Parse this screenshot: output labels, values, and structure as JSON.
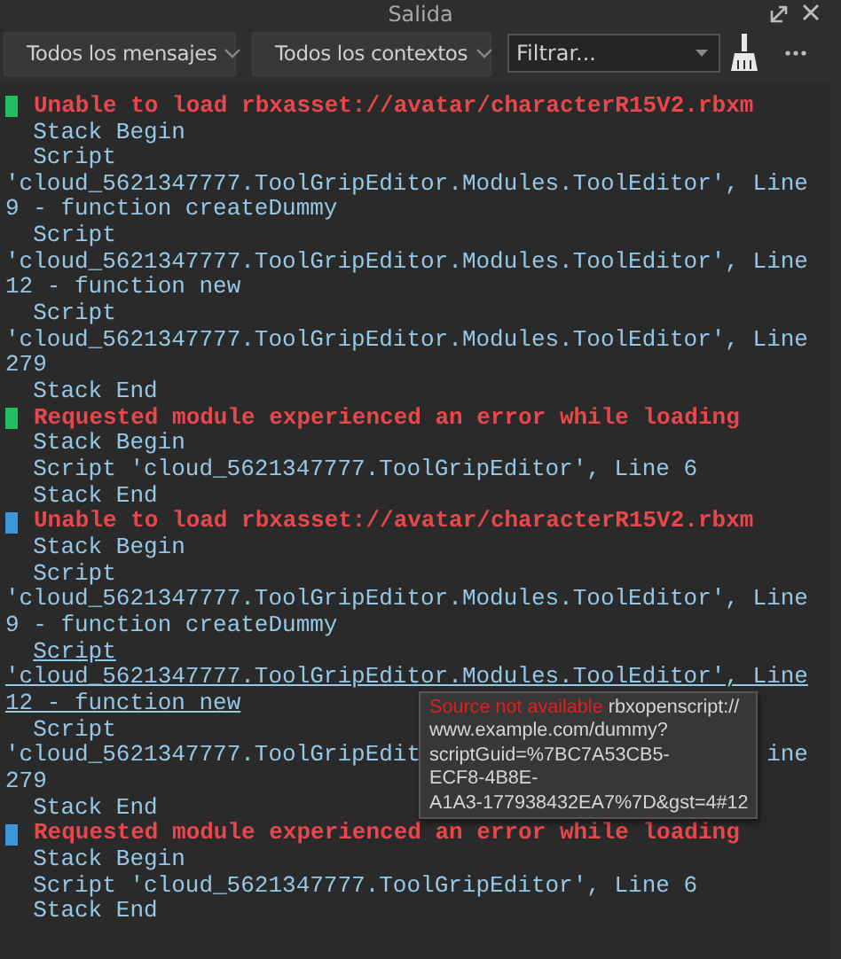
{
  "window": {
    "title": "Salida"
  },
  "toolbar": {
    "message_filter": "Todos los mensajes",
    "context_filter": "Todos los contextos",
    "search": {
      "placeholder": "Filtrar..."
    }
  },
  "messages": [
    {
      "color": "#1fbf5f",
      "title": "Unable to load rbxasset://avatar/characterR15V2.rbxm",
      "lines": [
        {
          "kind": "frame",
          "text": "Stack Begin",
          "hovered": false
        },
        {
          "kind": "frame",
          "text": "Script",
          "hovered": false
        },
        {
          "kind": "cont",
          "text": "'cloud_5621347777.ToolGripEditor.Modules.ToolEditor', Line",
          "hovered": false
        },
        {
          "kind": "cont",
          "text": "9 - function createDummy",
          "hovered": false
        },
        {
          "kind": "frame",
          "text": "Script",
          "hovered": false
        },
        {
          "kind": "cont",
          "text": "'cloud_5621347777.ToolGripEditor.Modules.ToolEditor', Line",
          "hovered": false
        },
        {
          "kind": "cont",
          "text": "12 - function new",
          "hovered": false
        },
        {
          "kind": "frame",
          "text": "Script",
          "hovered": false
        },
        {
          "kind": "cont",
          "text": "'cloud_5621347777.ToolGripEditor.Modules.ToolEditor', Line",
          "hovered": false
        },
        {
          "kind": "cont",
          "text": "279",
          "hovered": false
        },
        {
          "kind": "frame",
          "text": "Stack End",
          "hovered": false
        }
      ]
    },
    {
      "color": "#1fbf5f",
      "title": "Requested module experienced an error while loading",
      "lines": [
        {
          "kind": "frame",
          "text": "Stack Begin",
          "hovered": false
        },
        {
          "kind": "frame",
          "text": "Script 'cloud_5621347777.ToolGripEditor', Line 6",
          "hovered": false
        },
        {
          "kind": "frame",
          "text": "Stack End",
          "hovered": false
        }
      ]
    },
    {
      "color": "#3a96dd",
      "title": "Unable to load rbxasset://avatar/characterR15V2.rbxm",
      "lines": [
        {
          "kind": "frame",
          "text": "Stack Begin",
          "hovered": false
        },
        {
          "kind": "frame",
          "text": "Script",
          "hovered": false
        },
        {
          "kind": "cont",
          "text": "'cloud_5621347777.ToolGripEditor.Modules.ToolEditor', Line",
          "hovered": false
        },
        {
          "kind": "cont",
          "text": "9 - function createDummy",
          "hovered": false
        },
        {
          "kind": "frame",
          "text": "Script",
          "hovered": true
        },
        {
          "kind": "cont",
          "text": "'cloud_5621347777.ToolGripEditor.Modules.ToolEditor', Line",
          "hovered": true
        },
        {
          "kind": "cont",
          "text": "12 - function new",
          "hovered": true
        },
        {
          "kind": "frame",
          "text": "Script",
          "hovered": false
        },
        {
          "kind": "cont",
          "text": "'cloud_5621347777.ToolGripEdit",
          "tail": "ine",
          "hovered": false
        },
        {
          "kind": "cont",
          "text": "279",
          "hovered": false
        },
        {
          "kind": "frame",
          "text": "Stack End",
          "hovered": false
        }
      ]
    },
    {
      "color": "#3a96dd",
      "title": "Requested module experienced an error while loading",
      "lines": [
        {
          "kind": "frame",
          "text": "Stack Begin",
          "hovered": false
        },
        {
          "kind": "frame",
          "text": "Script 'cloud_5621347777.ToolGripEditor', Line 6",
          "hovered": false
        },
        {
          "kind": "frame",
          "text": "Stack End",
          "hovered": false
        }
      ]
    }
  ],
  "tooltip": {
    "label": "Source not available",
    "lines": [
      "rbxopenscript://",
      "www.example.com/dummy?",
      "scriptGuid=%7BC7A53CB5-",
      "ECF8-4B8E-",
      "A1A3-177938432EA7%7D&gst=4#12"
    ]
  }
}
